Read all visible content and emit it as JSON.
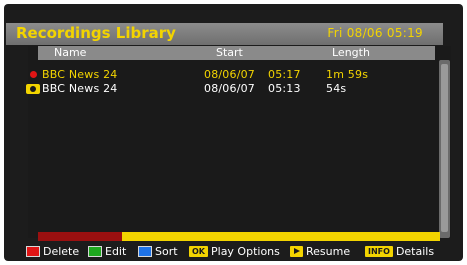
{
  "window": {
    "title": "Recordings Library",
    "datetime": "Fri 08/06 05:19"
  },
  "columns": {
    "name": "Name",
    "start": "Start",
    "length": "Length"
  },
  "recordings": [
    {
      "name": "BBC News 24",
      "date": "08/06/07",
      "time": "05:17",
      "length": "1m 59s",
      "status_icon": "recording-dot-icon",
      "selected": true
    },
    {
      "name": "BBC News 24",
      "date": "08/06/07",
      "time": "05:13",
      "length": "54s",
      "status_icon": "watched-eye-icon",
      "selected": false
    }
  ],
  "usage": {
    "used_fraction": 0.21
  },
  "legend": {
    "delete": "Delete",
    "edit": "Edit",
    "sort": "Sort",
    "ok_key": "OK",
    "play_options": "Play Options",
    "resume": "Resume",
    "info_key": "INFO",
    "details": "Details"
  },
  "colors": {
    "accent_yellow": "#f3d400",
    "red": "#e01515",
    "green": "#1fa81f",
    "blue": "#1e73e8",
    "used_bar": "#9a1010"
  }
}
